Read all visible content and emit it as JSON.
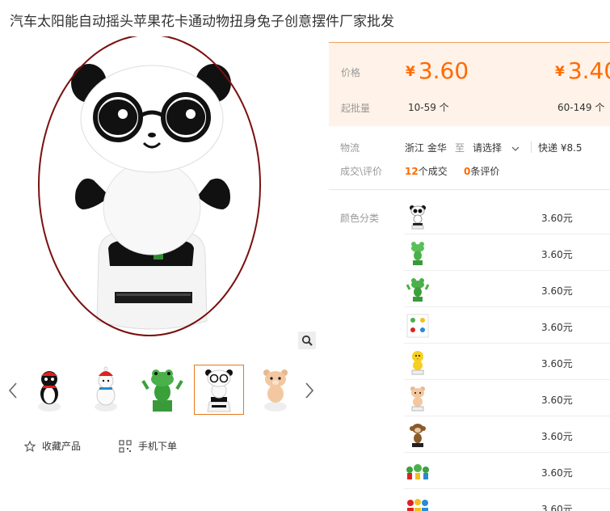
{
  "product": {
    "title": "汽车太阳能自动摇头苹果花卡通动物扭身兔子创意摆件厂家批发"
  },
  "gallery": {
    "thumbnails": [
      {
        "name": "penguin"
      },
      {
        "name": "snowman"
      },
      {
        "name": "frog"
      },
      {
        "name": "panda",
        "active": true
      },
      {
        "name": "bear"
      }
    ]
  },
  "actions": {
    "favorite": "收藏产品",
    "mobile_order": "手机下单"
  },
  "pricing": {
    "price_label": "价格",
    "moq_label": "起批量",
    "currency": "¥",
    "tiers": [
      {
        "price": "3.60",
        "range": "10-59 个"
      },
      {
        "price": "3.40",
        "range": "60-149 个"
      }
    ]
  },
  "logistics": {
    "label": "物流",
    "origin": "浙江 金华",
    "to": "至",
    "destination": "请选择",
    "shipping": "快递 ¥8.5"
  },
  "deals": {
    "label": "成交\\评价",
    "count": "12",
    "count_suffix": "个成交",
    "reviews": "0",
    "reviews_suffix": "条评价"
  },
  "sku": {
    "label": "颜色分类",
    "items": [
      {
        "name": "panda",
        "price": "3.60元"
      },
      {
        "name": "frog",
        "price": "3.60元"
      },
      {
        "name": "frog-flower",
        "price": "3.60元"
      },
      {
        "name": "mixed-set",
        "price": "3.60元"
      },
      {
        "name": "chick",
        "price": "3.60元"
      },
      {
        "name": "bear",
        "price": "3.60元"
      },
      {
        "name": "monkey",
        "price": "3.60元"
      },
      {
        "name": "flower-pots",
        "price": "3.60元"
      },
      {
        "name": "multi-figures",
        "price": "3.60元"
      }
    ]
  },
  "colors": {
    "accent": "#ff6a00",
    "price_bg": "#fff2e8",
    "active_border": "#e4791f",
    "circle": "#7a1010"
  }
}
